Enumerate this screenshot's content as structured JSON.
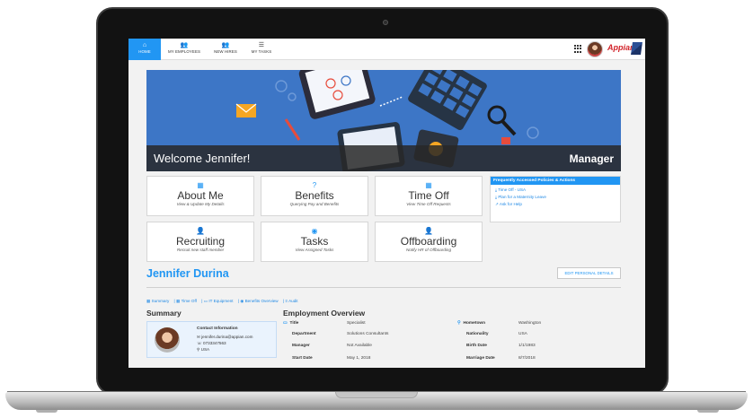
{
  "nav": {
    "items": [
      {
        "label": "HOME",
        "icon": "home-icon",
        "glyph": "⌂"
      },
      {
        "label": "MY EMPLOYEES",
        "icon": "people-icon",
        "glyph": "👥"
      },
      {
        "label": "NEW HIRES",
        "icon": "people-icon",
        "glyph": "👥"
      },
      {
        "label": "MY TASKS",
        "icon": "tasks-icon",
        "glyph": "☰"
      }
    ],
    "logo": "Appian"
  },
  "banner": {
    "welcome": "Welcome Jennifer!",
    "role": "Manager"
  },
  "tiles": [
    {
      "title": "About Me",
      "subtitle": "View & Update My Details",
      "icon": "calendar-icon",
      "glyph": "▦"
    },
    {
      "title": "Benefits",
      "subtitle": "Querying Pay and Benefits",
      "icon": "question-icon",
      "glyph": "?"
    },
    {
      "title": "Time Off",
      "subtitle": "View Time Off Requests",
      "icon": "calendar-check-icon",
      "glyph": "▦"
    },
    {
      "title": "Recruiting",
      "subtitle": "Recruit new staff member",
      "icon": "user-plus-icon",
      "glyph": "👤"
    },
    {
      "title": "Tasks",
      "subtitle": "View Assigned Tasks",
      "icon": "user-circle-icon",
      "glyph": "◉"
    },
    {
      "title": "Offboarding",
      "subtitle": "Notify HR of Offboarding",
      "icon": "user-minus-icon",
      "glyph": "👤"
    }
  ],
  "policies": {
    "heading": "Frequently Accessed Policies & Actions",
    "links": [
      "Time Off - USA",
      "Plan for a Maternity Leave",
      "Ask for Help"
    ]
  },
  "profile": {
    "name": "Jennifer Durina",
    "edit_label": "EDIT PERSONAL DETAILS",
    "tabs": [
      "Summary",
      "Time Off",
      "IT Equipment",
      "Benefits Overview",
      "Audit"
    ],
    "summary_heading": "Summary",
    "employment_heading": "Employment Overview",
    "contact": {
      "title": "Contact Information",
      "email": "jennifer.durina@appian.com",
      "phone": "0733347563",
      "country": "USA"
    },
    "fields": [
      {
        "label": "Title",
        "value": "Specialist"
      },
      {
        "label": "Department",
        "value": "Solutions Consultants"
      },
      {
        "label": "Manager",
        "value": "Not Available"
      },
      {
        "label": "Start Date",
        "value": "May 1, 2018"
      },
      {
        "label": "Hometown",
        "value": "Washington"
      },
      {
        "label": "Nationality",
        "value": "USA"
      },
      {
        "label": "Birth Date",
        "value": "1/1/1983"
      },
      {
        "label": "Marriage Date",
        "value": "8/7/2018"
      }
    ]
  },
  "colors": {
    "accent": "#2196f3",
    "banner": "#3d76c6",
    "brand": "#d2232a"
  }
}
